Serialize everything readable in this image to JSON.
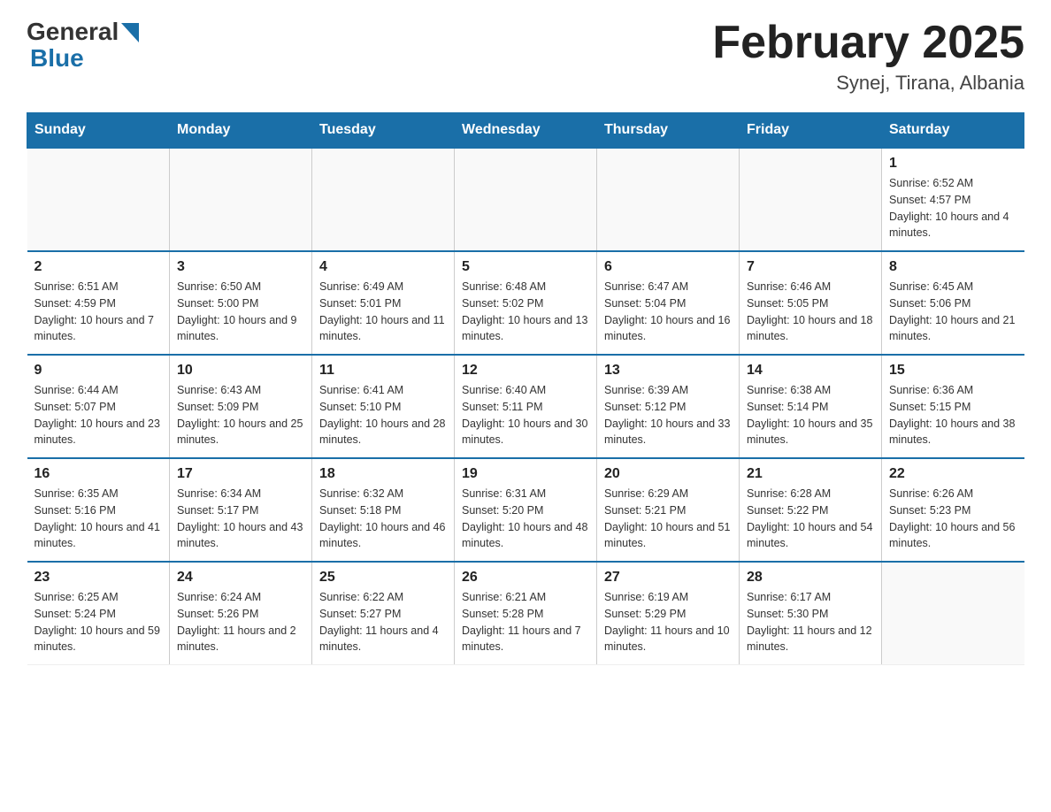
{
  "header": {
    "title": "February 2025",
    "subtitle": "Synej, Tirana, Albania",
    "logo_general": "General",
    "logo_blue": "Blue"
  },
  "days_of_week": [
    "Sunday",
    "Monday",
    "Tuesday",
    "Wednesday",
    "Thursday",
    "Friday",
    "Saturday"
  ],
  "weeks": [
    {
      "days": [
        {
          "number": "",
          "info": ""
        },
        {
          "number": "",
          "info": ""
        },
        {
          "number": "",
          "info": ""
        },
        {
          "number": "",
          "info": ""
        },
        {
          "number": "",
          "info": ""
        },
        {
          "number": "",
          "info": ""
        },
        {
          "number": "1",
          "info": "Sunrise: 6:52 AM\nSunset: 4:57 PM\nDaylight: 10 hours and 4 minutes."
        }
      ]
    },
    {
      "days": [
        {
          "number": "2",
          "info": "Sunrise: 6:51 AM\nSunset: 4:59 PM\nDaylight: 10 hours and 7 minutes."
        },
        {
          "number": "3",
          "info": "Sunrise: 6:50 AM\nSunset: 5:00 PM\nDaylight: 10 hours and 9 minutes."
        },
        {
          "number": "4",
          "info": "Sunrise: 6:49 AM\nSunset: 5:01 PM\nDaylight: 10 hours and 11 minutes."
        },
        {
          "number": "5",
          "info": "Sunrise: 6:48 AM\nSunset: 5:02 PM\nDaylight: 10 hours and 13 minutes."
        },
        {
          "number": "6",
          "info": "Sunrise: 6:47 AM\nSunset: 5:04 PM\nDaylight: 10 hours and 16 minutes."
        },
        {
          "number": "7",
          "info": "Sunrise: 6:46 AM\nSunset: 5:05 PM\nDaylight: 10 hours and 18 minutes."
        },
        {
          "number": "8",
          "info": "Sunrise: 6:45 AM\nSunset: 5:06 PM\nDaylight: 10 hours and 21 minutes."
        }
      ]
    },
    {
      "days": [
        {
          "number": "9",
          "info": "Sunrise: 6:44 AM\nSunset: 5:07 PM\nDaylight: 10 hours and 23 minutes."
        },
        {
          "number": "10",
          "info": "Sunrise: 6:43 AM\nSunset: 5:09 PM\nDaylight: 10 hours and 25 minutes."
        },
        {
          "number": "11",
          "info": "Sunrise: 6:41 AM\nSunset: 5:10 PM\nDaylight: 10 hours and 28 minutes."
        },
        {
          "number": "12",
          "info": "Sunrise: 6:40 AM\nSunset: 5:11 PM\nDaylight: 10 hours and 30 minutes."
        },
        {
          "number": "13",
          "info": "Sunrise: 6:39 AM\nSunset: 5:12 PM\nDaylight: 10 hours and 33 minutes."
        },
        {
          "number": "14",
          "info": "Sunrise: 6:38 AM\nSunset: 5:14 PM\nDaylight: 10 hours and 35 minutes."
        },
        {
          "number": "15",
          "info": "Sunrise: 6:36 AM\nSunset: 5:15 PM\nDaylight: 10 hours and 38 minutes."
        }
      ]
    },
    {
      "days": [
        {
          "number": "16",
          "info": "Sunrise: 6:35 AM\nSunset: 5:16 PM\nDaylight: 10 hours and 41 minutes."
        },
        {
          "number": "17",
          "info": "Sunrise: 6:34 AM\nSunset: 5:17 PM\nDaylight: 10 hours and 43 minutes."
        },
        {
          "number": "18",
          "info": "Sunrise: 6:32 AM\nSunset: 5:18 PM\nDaylight: 10 hours and 46 minutes."
        },
        {
          "number": "19",
          "info": "Sunrise: 6:31 AM\nSunset: 5:20 PM\nDaylight: 10 hours and 48 minutes."
        },
        {
          "number": "20",
          "info": "Sunrise: 6:29 AM\nSunset: 5:21 PM\nDaylight: 10 hours and 51 minutes."
        },
        {
          "number": "21",
          "info": "Sunrise: 6:28 AM\nSunset: 5:22 PM\nDaylight: 10 hours and 54 minutes."
        },
        {
          "number": "22",
          "info": "Sunrise: 6:26 AM\nSunset: 5:23 PM\nDaylight: 10 hours and 56 minutes."
        }
      ]
    },
    {
      "days": [
        {
          "number": "23",
          "info": "Sunrise: 6:25 AM\nSunset: 5:24 PM\nDaylight: 10 hours and 59 minutes."
        },
        {
          "number": "24",
          "info": "Sunrise: 6:24 AM\nSunset: 5:26 PM\nDaylight: 11 hours and 2 minutes."
        },
        {
          "number": "25",
          "info": "Sunrise: 6:22 AM\nSunset: 5:27 PM\nDaylight: 11 hours and 4 minutes."
        },
        {
          "number": "26",
          "info": "Sunrise: 6:21 AM\nSunset: 5:28 PM\nDaylight: 11 hours and 7 minutes."
        },
        {
          "number": "27",
          "info": "Sunrise: 6:19 AM\nSunset: 5:29 PM\nDaylight: 11 hours and 10 minutes."
        },
        {
          "number": "28",
          "info": "Sunrise: 6:17 AM\nSunset: 5:30 PM\nDaylight: 11 hours and 12 minutes."
        },
        {
          "number": "",
          "info": ""
        }
      ]
    }
  ]
}
